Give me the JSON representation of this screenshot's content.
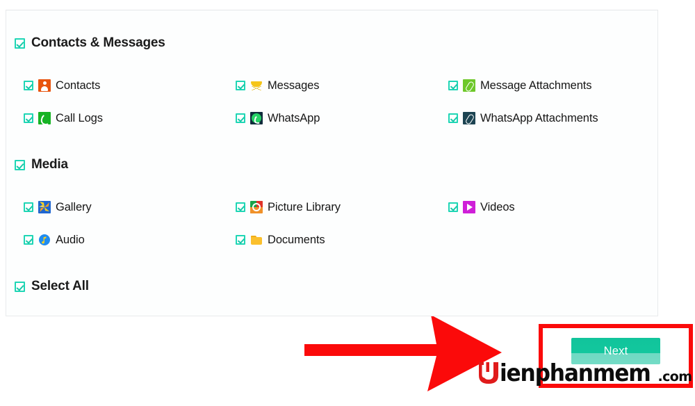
{
  "panel": {
    "groups": [
      {
        "id": "contacts-messages",
        "label": "Contacts & Messages",
        "checked": true,
        "items": [
          {
            "label": "Contacts",
            "icon": "contacts-icon",
            "checked": true,
            "col": 1,
            "row": 1
          },
          {
            "label": "Messages",
            "icon": "messages-envelope-icon",
            "checked": true,
            "col": 2,
            "row": 1
          },
          {
            "label": "Message Attachments",
            "icon": "message-attachment-clip-icon",
            "checked": true,
            "col": 3,
            "row": 1
          },
          {
            "label": "Call Logs",
            "icon": "call-logs-phone-icon",
            "checked": true,
            "col": 1,
            "row": 2
          },
          {
            "label": "WhatsApp",
            "icon": "whatsapp-icon",
            "checked": true,
            "col": 2,
            "row": 2
          },
          {
            "label": "WhatsApp Attachments",
            "icon": "whatsapp-attachment-clip-icon",
            "checked": true,
            "col": 3,
            "row": 2
          }
        ]
      },
      {
        "id": "media",
        "label": "Media",
        "checked": true,
        "items": [
          {
            "label": "Gallery",
            "icon": "gallery-pinwheel-icon",
            "checked": true,
            "col": 1,
            "row": 1
          },
          {
            "label": "Picture Library",
            "icon": "picture-library-icon",
            "checked": true,
            "col": 2,
            "row": 1
          },
          {
            "label": "Videos",
            "icon": "videos-play-icon",
            "checked": true,
            "col": 3,
            "row": 1
          },
          {
            "label": "Audio",
            "icon": "audio-note-icon",
            "checked": true,
            "col": 1,
            "row": 2
          },
          {
            "label": "Documents",
            "icon": "documents-folder-icon",
            "checked": true,
            "col": 2,
            "row": 2
          }
        ]
      }
    ],
    "select_all": {
      "label": "Select All",
      "checked": true
    }
  },
  "footer": {
    "next_label": "Next"
  },
  "annotation": {
    "arrow": "red-arrow-pointing-right",
    "highlight": "red-rectangle-around-next-button",
    "color": "#fb0a0a"
  },
  "watermark": {
    "name": "ienphanmem",
    "tld": ".com",
    "mark_color": "#e01b1b"
  },
  "colors": {
    "checkbox": "#1fd6b5",
    "next_button": "#12c79e",
    "annotation_red": "#fb0a0a",
    "panel_border": "#e8eaec"
  }
}
